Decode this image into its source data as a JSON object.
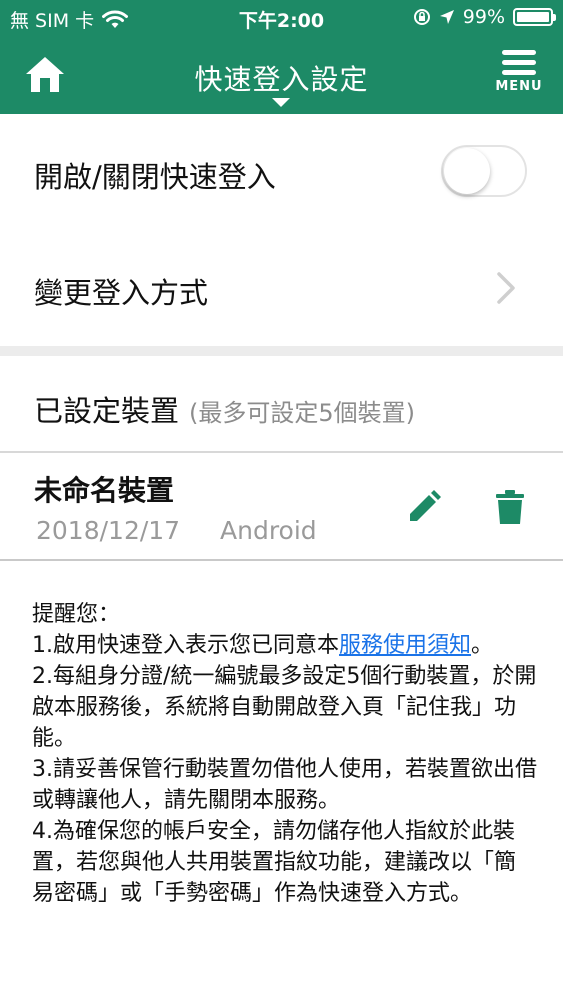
{
  "status_bar": {
    "carrier": "無 SIM 卡",
    "time": "下午2:00",
    "battery": "99%",
    "battery_level": 0.99
  },
  "nav": {
    "title": "快速登入設定",
    "menu_label": "MENU"
  },
  "settings": {
    "quick_login_label": "開啟/關閉快速登入",
    "quick_login_enabled": false,
    "change_method_label": "變更登入方式"
  },
  "devices_section": {
    "title": "已設定裝置",
    "hint": "(最多可設定5個裝置)",
    "devices": [
      {
        "name": "未命名裝置",
        "date": "2018/12/17",
        "os": "Android"
      }
    ]
  },
  "notice": {
    "heading": "提醒您：",
    "item1_prefix": "1.啟用快速登入表示您已同意本",
    "item1_link": "服務使用須知",
    "item1_suffix": "。",
    "item2": "2.每組身分證/統一編號最多設定5個行動裝置，於開啟本服務後，系統將自動開啟登入頁「記住我」功能。",
    "item3": "3.請妥善保管行動裝置勿借他人使用，若裝置欲出借或轉讓他人，請先關閉本服務。",
    "item4": "4.為確保您的帳戶安全，請勿儲存他人指紋於此裝置，若您與他人共用裝置指紋功能，建議改以「簡易密碼」或「手勢密碼」作為快速登入方式。"
  },
  "colors": {
    "brand_green": "#1d8a66",
    "link_blue": "#1a73e8"
  }
}
